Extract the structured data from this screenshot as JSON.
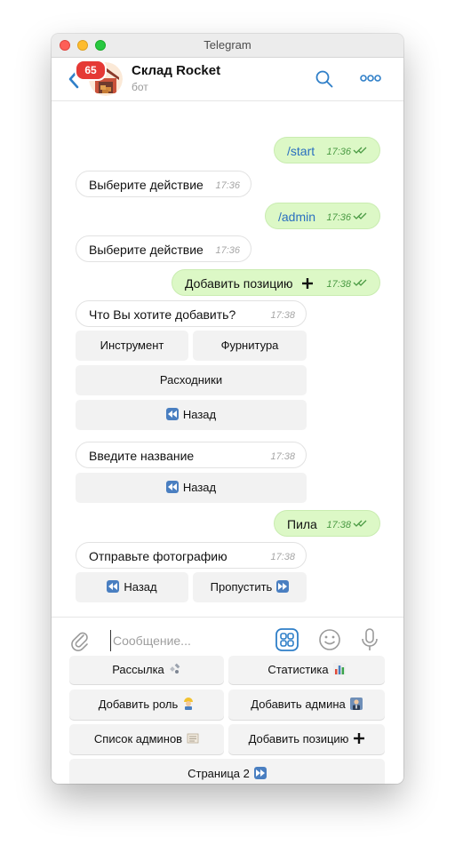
{
  "window": {
    "title": "Telegram"
  },
  "header": {
    "back_label": "<",
    "unread_count": "65",
    "chat_name": "Склад Rocket",
    "chat_subtitle": "бот",
    "search_icon": "search-icon",
    "more_icon": "more-icon"
  },
  "messages": [
    {
      "direction": "out",
      "text": "/start",
      "time": "17:36"
    },
    {
      "direction": "in",
      "text": "Выберите действие",
      "time": "17:36"
    },
    {
      "direction": "out",
      "text": "/admin",
      "time": "17:36"
    },
    {
      "direction": "in",
      "text": "Выберите действие",
      "time": "17:36"
    },
    {
      "direction": "out",
      "text": "Добавить позицию",
      "time": "17:38"
    },
    {
      "direction": "in",
      "text": "Что Вы хотите добавить?",
      "time": "17:38"
    },
    {
      "direction": "in",
      "text": "Введите название",
      "time": "17:38"
    },
    {
      "direction": "out",
      "text": "Пила",
      "time": "17:38"
    },
    {
      "direction": "in",
      "text": "Отправьте фотографию",
      "time": "17:38"
    }
  ],
  "inline_keyboards": {
    "add_what": {
      "tool": "Инструмент",
      "fittings": "Фурнитура",
      "consumables": "Расходники",
      "back": "Назад"
    },
    "enter_name": {
      "back": "Назад"
    },
    "send_photo": {
      "back": "Назад",
      "skip": "Пропустить"
    }
  },
  "composer": {
    "placeholder": "Сообщение...",
    "attach_icon": "paperclip-icon",
    "commands_icon": "bot-commands-icon",
    "emoji_icon": "emoji-icon",
    "mic_icon": "microphone-icon"
  },
  "reply_keyboard": {
    "broadcast": "Рассылка",
    "stats": "Статистика",
    "add_role": "Добавить роль",
    "add_admin": "Добавить админа",
    "admin_list": "Список админов",
    "add_position": "Добавить позицию",
    "page2": "Страница 2"
  },
  "colors": {
    "outgoing_bubble": "#dcf8c6",
    "incoming_bubble": "#ffffff",
    "accent": "#2f7fc8",
    "badge": "#e53935"
  }
}
